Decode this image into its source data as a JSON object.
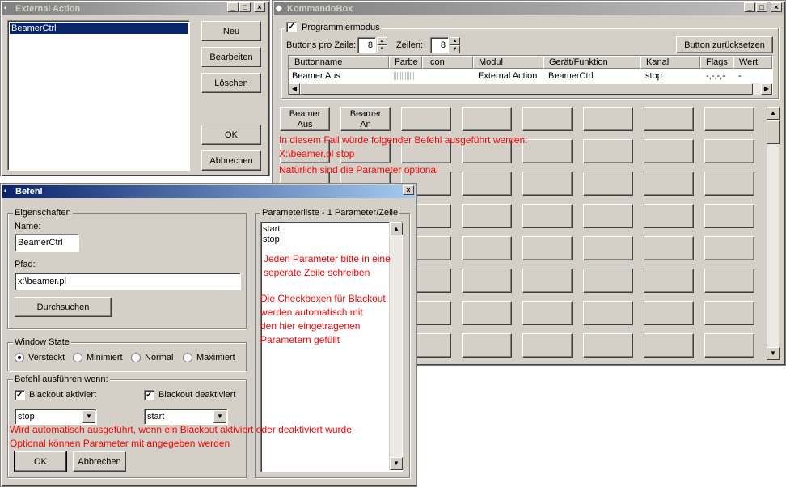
{
  "external_action": {
    "title": "External Action",
    "list_items": [
      "BeamerCtrl"
    ],
    "buttons": {
      "new": "Neu",
      "edit": "Bearbeiten",
      "delete": "Löschen",
      "ok": "OK",
      "cancel": "Abbrechen"
    }
  },
  "kommandobox": {
    "title": "KommandoBox",
    "mode_group": "Programmiermodus",
    "buttons_per_row_label": "Buttons pro Zeile:",
    "buttons_per_row": "8",
    "rows_label": "Zeilen:",
    "rows": "8",
    "reset_button": "Button zurücksetzen",
    "table_headers": [
      "Buttonname",
      "Farbe",
      "Icon",
      "Modul",
      "Gerät/Funktion",
      "Kanal",
      "Flags",
      "Wert"
    ],
    "table_row": {
      "name": "Beamer Aus",
      "modul": "External Action",
      "device": "BeamerCtrl",
      "channel": "stop",
      "flags": "-,-,-,-",
      "value": "-"
    },
    "grid_button_1": "Beamer\nAus",
    "grid_button_2": "Beamer\nAn"
  },
  "befehl": {
    "title": "Befehl",
    "props_group": "Eigenschaften",
    "name_label": "Name:",
    "name_value": "BeamerCtrl",
    "path_label": "Pfad:",
    "path_value": "x:\\beamer.pl",
    "browse_button": "Durchsuchen",
    "window_state_group": "Window State",
    "radio_versteckt": "Versteckt",
    "radio_minimiert": "Minimiert",
    "radio_normal": "Normal",
    "radio_maximiert": "Maximiert",
    "exec_group": "Befehl ausführen wenn:",
    "cb_blackout_on": "Blackout aktiviert",
    "cb_blackout_off": "Blackout deaktiviert",
    "combo_on_value": "stop",
    "combo_off_value": "start",
    "ok_button": "OK",
    "cancel_button": "Abbrechen",
    "param_group": "Parameterliste - 1 Parameter/Zeile",
    "params": [
      "start",
      "stop"
    ]
  },
  "annotations": {
    "a1": "In diesem Fall würde folgender Befehl ausgeführt werden:",
    "a2": "X:\\beamer.pl stop",
    "a3": "Natürlich sind die Parameter optional",
    "a4": "Jeden Parameter bitte in eine",
    "a5": "seperate Zeile schreiben",
    "a6": "Die Checkboxen für Blackout",
    "a7": "werden automatisch mit",
    "a8": "den hier eingetragenen",
    "a9": "Parametern gefüllt",
    "a10": "Wird automatisch ausgeführt, wenn ein Blackout aktiviert oder deaktiviert wurde",
    "a11": "Optional können Parameter mit angegeben werden"
  },
  "colors": {
    "title_active": "#0a246a",
    "title_inactive": "#808080",
    "annotation": "#ff0000",
    "face": "#d4d0c8"
  }
}
